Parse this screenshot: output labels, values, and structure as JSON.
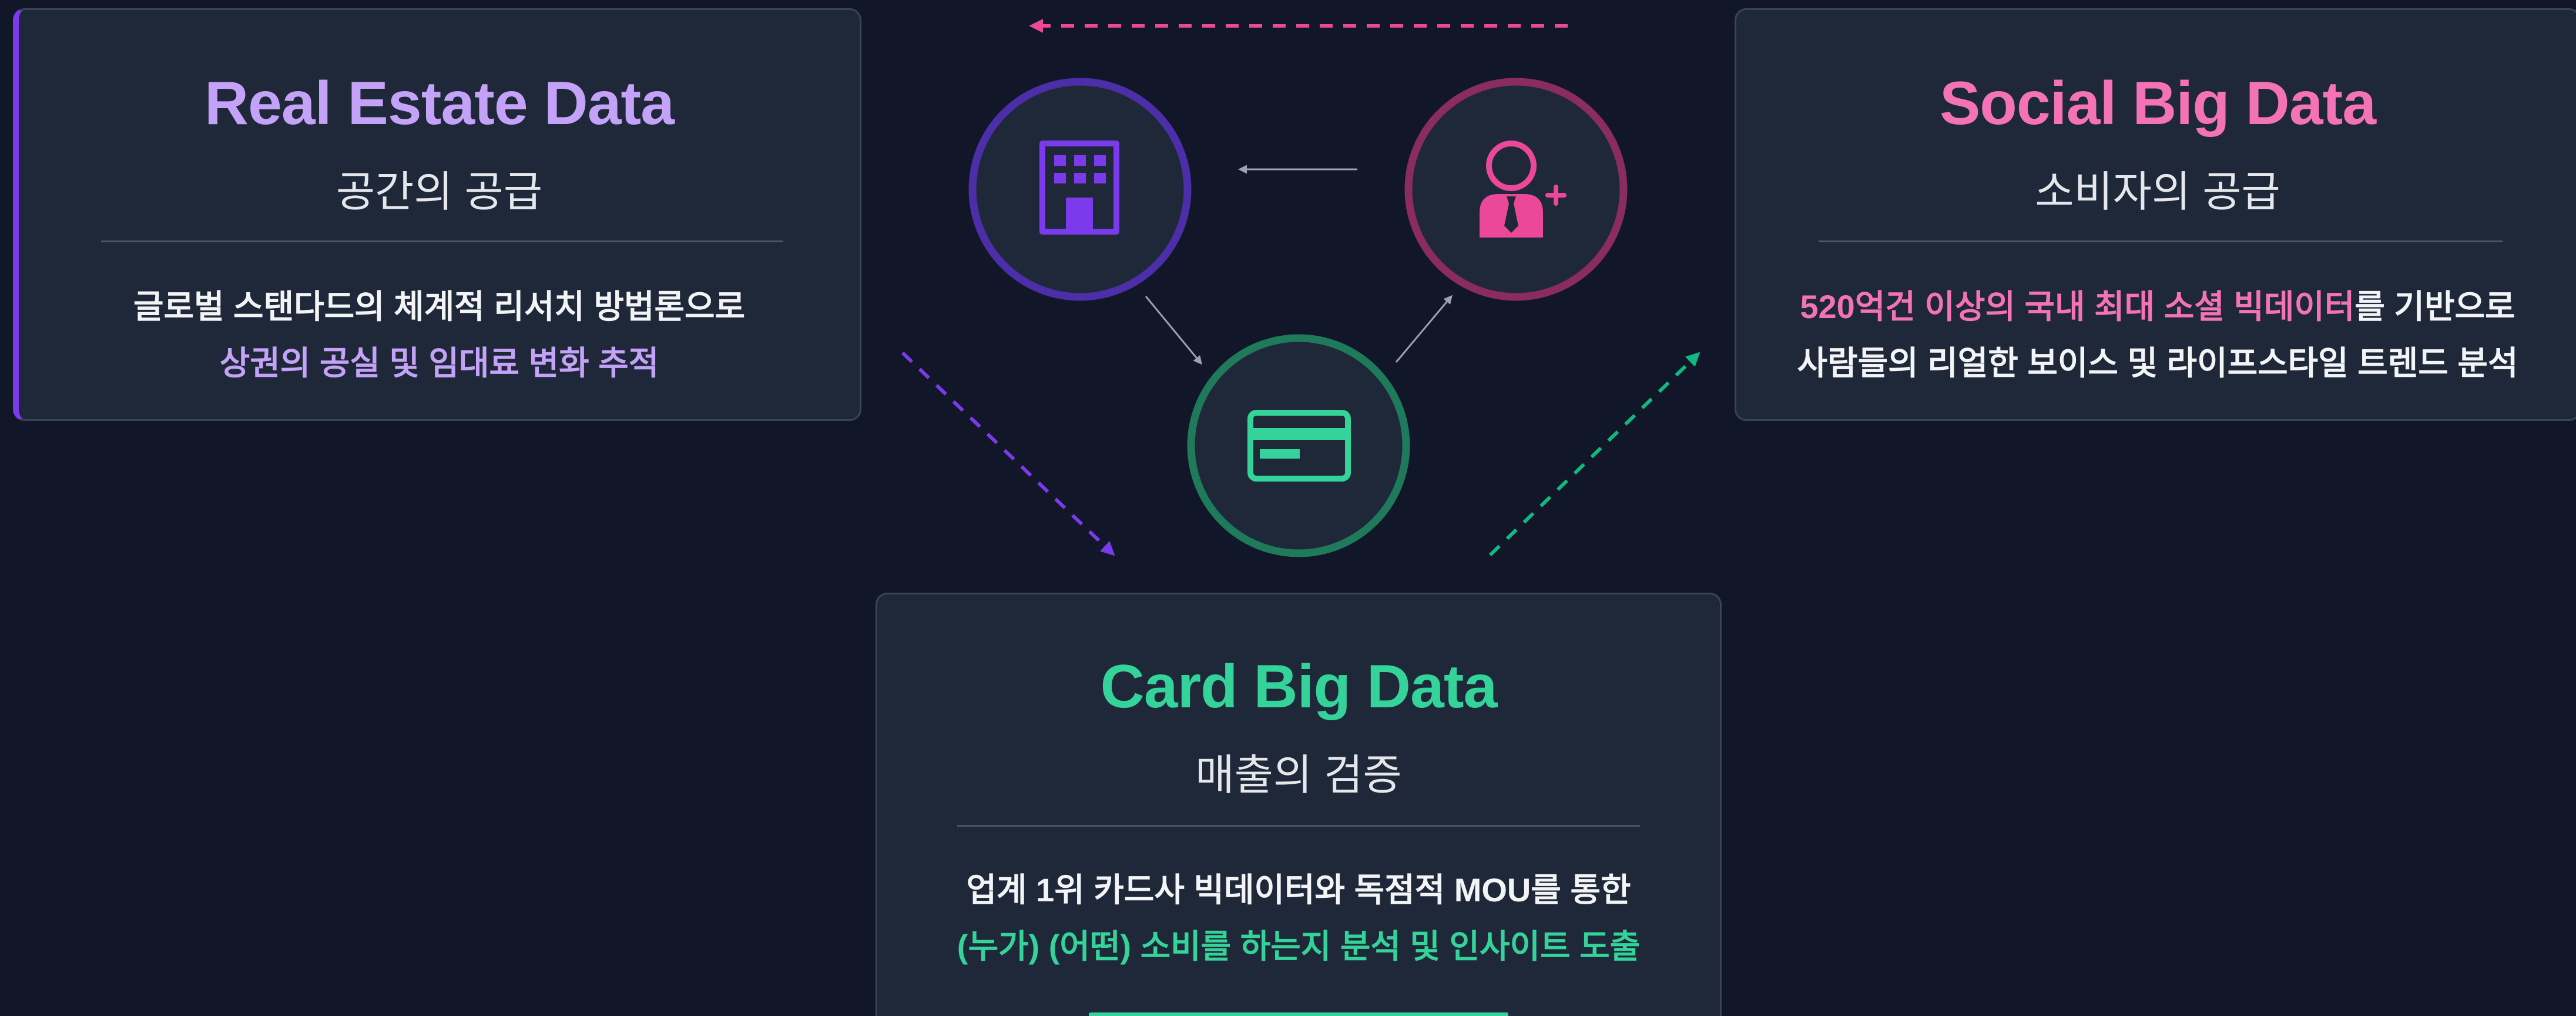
{
  "real_estate": {
    "title": "Real Estate Data",
    "subtitle": "공간의 공급",
    "line1": "글로벌 스탠다드의 체계적 리서치 방법론으로",
    "line2": "상권의 공실 및 임대료 변화 추적"
  },
  "social": {
    "title": "Social Big Data",
    "subtitle": "소비자의 공급",
    "line1_highlight": "520억건 이상의 국내 최대 소셜 빅데이터",
    "line1_rest": "를 기반으로",
    "line2": "사람들의 리얼한 보이스 및 라이프스타일 트렌드 분석"
  },
  "card": {
    "title": "Card Big Data",
    "subtitle": "매출의 검증",
    "line1": "업계 1위 카드사 빅데이터와 독점적 MOU를 통한",
    "line2": "(누가) (어떤) 소비를 하는지 분석 및 인사이트 도출"
  },
  "icons": {
    "real_estate": "building-icon",
    "social": "user-plus-icon",
    "card": "credit-card-icon"
  },
  "colors": {
    "background": "#111628",
    "card_bg": "#1e2839",
    "purple": "#7c3aed",
    "purple_text": "#c4a2f8",
    "pink": "#ec4899",
    "pink_text": "#f472b6",
    "green": "#34d399"
  }
}
